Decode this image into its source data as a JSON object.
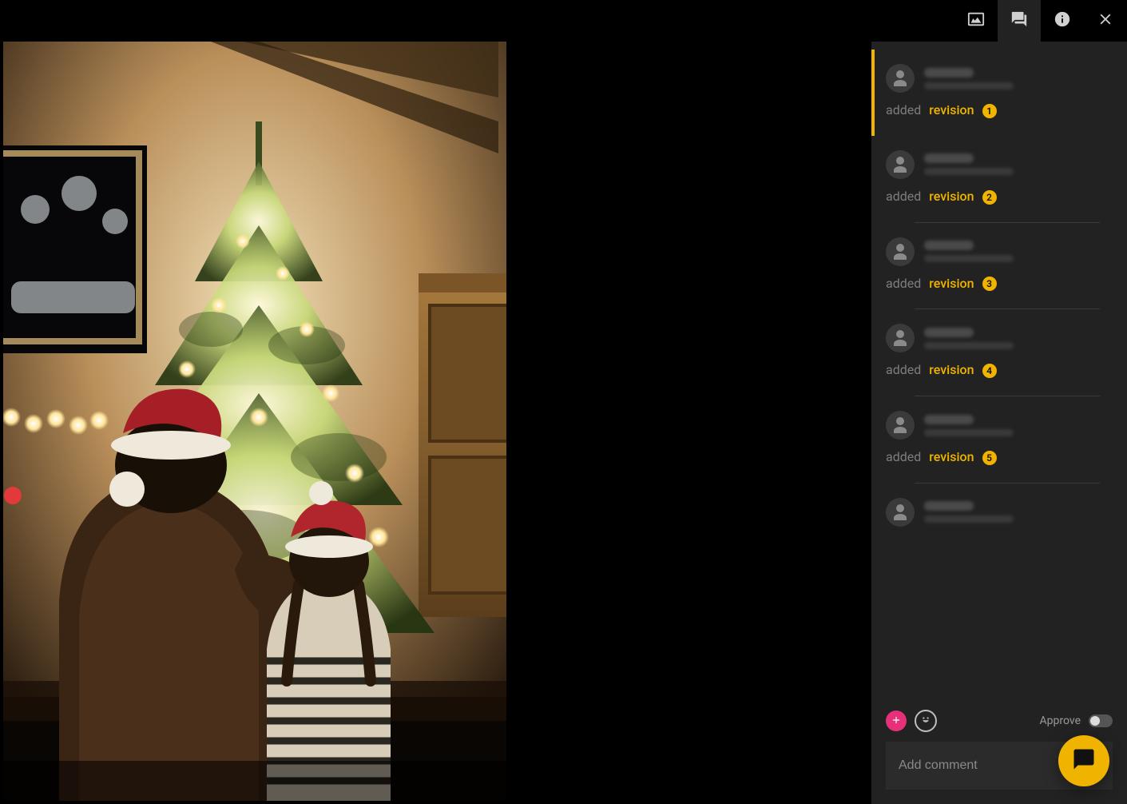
{
  "tabs": {
    "image": "image-tab",
    "comments": "comments-tab",
    "info": "info-tab",
    "close": "close-tab",
    "active": "comments"
  },
  "activity": [
    {
      "action_added": "added",
      "action_revision": "revision",
      "badge": "1",
      "selected": true
    },
    {
      "action_added": "added",
      "action_revision": "revision",
      "badge": "2",
      "selected": false
    },
    {
      "action_added": "added",
      "action_revision": "revision",
      "badge": "3",
      "selected": false
    },
    {
      "action_added": "added",
      "action_revision": "revision",
      "badge": "4",
      "selected": false
    },
    {
      "action_added": "added",
      "action_revision": "revision",
      "badge": "5",
      "selected": false
    },
    {
      "action_added": "",
      "action_revision": "",
      "badge": "",
      "selected": false
    }
  ],
  "footer": {
    "approve_label": "Approve",
    "comment_placeholder": "Add comment"
  },
  "colors": {
    "accent_yellow": "#f0b400",
    "accent_pink": "#e6317a",
    "panel_bg": "#222222",
    "text_muted": "#7d7d7d"
  }
}
